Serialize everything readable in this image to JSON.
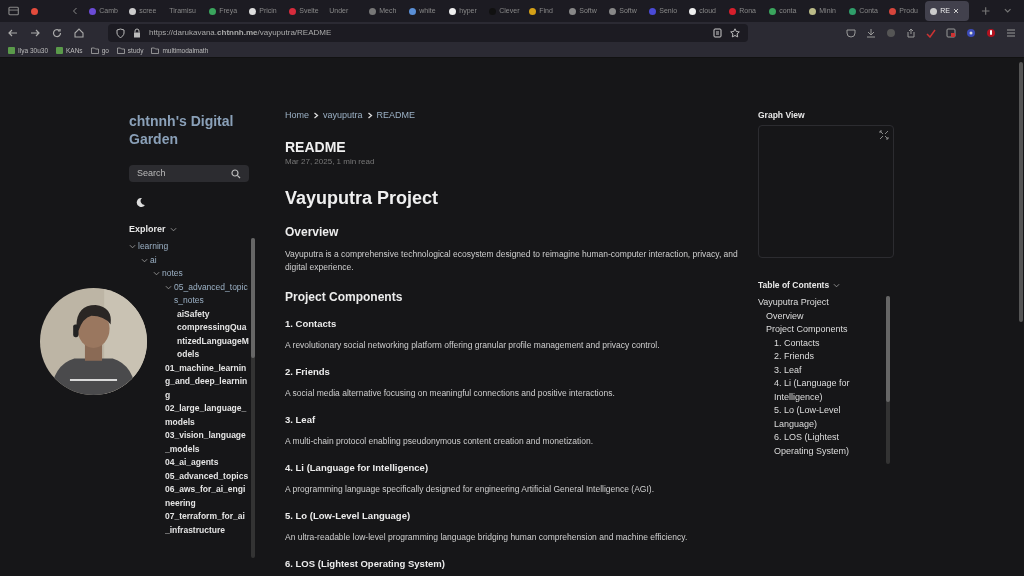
{
  "browser": {
    "tabs": [
      {
        "selected": false,
        "color": "#e44b3c"
      },
      {
        "title": "Camb",
        "selected": false,
        "color": "#6b4bd6"
      },
      {
        "title": "scree",
        "selected": false,
        "color": "#cccccc"
      },
      {
        "title": "Tiramisu",
        "selected": false
      },
      {
        "title": "Freya",
        "selected": false,
        "color": "#3aa55d"
      },
      {
        "title": "Pricin",
        "selected": false,
        "color": "#dddddd"
      },
      {
        "title": "Svelte",
        "selected": false,
        "color": "#d62b3c"
      },
      {
        "title": "Under",
        "selected": false
      },
      {
        "title": "Mech",
        "selected": false,
        "color": "#777777"
      },
      {
        "title": "white",
        "selected": false,
        "color": "#5a8fd6"
      },
      {
        "title": "hyper",
        "selected": false,
        "color": "#eeeeee"
      },
      {
        "title": "Clever",
        "selected": false,
        "color": "#111111"
      },
      {
        "title": "Find",
        "selected": false,
        "color": "#d4a017"
      },
      {
        "title": "Softw",
        "selected": false,
        "color": "#888888"
      },
      {
        "title": "Softw",
        "selected": false,
        "color": "#888888"
      },
      {
        "title": "Senio",
        "selected": false,
        "color": "#4a4ad6"
      },
      {
        "title": "cloud",
        "selected": false,
        "color": "#eeeeee"
      },
      {
        "title": "Rona",
        "selected": false,
        "color": "#d61f2c"
      },
      {
        "title": "conta",
        "selected": false,
        "color": "#3aa55d"
      },
      {
        "title": "Minin",
        "selected": false,
        "color": "#bbbb88"
      },
      {
        "title": "Conta",
        "selected": false,
        "color": "#2f9e6a"
      },
      {
        "title": "Produ",
        "selected": false,
        "color": "#d6453c"
      },
      {
        "title": "RE",
        "selected": true,
        "color": "#cccccc"
      }
    ],
    "url": "https://darukavana.**chtnnh.me**/vayuputra/README",
    "bookmarks": [
      {
        "label": "Ilya 30u30",
        "kind": "site"
      },
      {
        "label": "KANs",
        "kind": "site"
      },
      {
        "label": "go",
        "kind": "folder"
      },
      {
        "label": "study",
        "kind": "folder"
      },
      {
        "label": "multimodalmath",
        "kind": "folder"
      }
    ]
  },
  "sidebar": {
    "site_title": "chtnnh's Digital Garden",
    "search": {
      "placeholder": "Search"
    },
    "explorer": {
      "title": "Explorer",
      "expanded": true,
      "items": [
        {
          "label": "learning",
          "kind": "folder",
          "expanded": true,
          "children": [
            {
              "label": "ai",
              "kind": "folder",
              "expanded": true,
              "children": [
                {
                  "label": "notes",
                  "kind": "folder",
                  "expanded": true,
                  "children": [
                    {
                      "label": "05_advanced_topics_notes",
                      "kind": "folder",
                      "expanded": true,
                      "children": [
                        {
                          "label": "aiSafety",
                          "kind": "file"
                        },
                        {
                          "label": "compressingQuantizedLanguageModels",
                          "kind": "file"
                        }
                      ]
                    },
                    {
                      "label": "01_machine_learning_and_deep_learning",
                      "kind": "file"
                    },
                    {
                      "label": "02_large_language_models",
                      "kind": "file"
                    },
                    {
                      "label": "03_vision_language_models",
                      "kind": "file"
                    },
                    {
                      "label": "04_ai_agents",
                      "kind": "file"
                    },
                    {
                      "label": "05_advanced_topics",
                      "kind": "file"
                    },
                    {
                      "label": "06_aws_for_ai_engineering",
                      "kind": "file"
                    },
                    {
                      "label": "07_terraform_for_ai_infrastructure",
                      "kind": "file"
                    }
                  ]
                }
              ]
            }
          ]
        }
      ]
    }
  },
  "article": {
    "breadcrumbs": [
      "Home",
      "vayuputra",
      "README"
    ],
    "title": "README",
    "meta": "Mar 27, 2025, 1 min read",
    "heading": "Vayuputra Project",
    "blocks": [
      {
        "kind": "h2",
        "text": "Overview"
      },
      {
        "kind": "p",
        "text": "Vayuputra is a comprehensive technological ecosystem designed to reimagine human-computer interaction, privacy, and digital experience."
      },
      {
        "kind": "h2",
        "text": "Project Components"
      },
      {
        "kind": "h3",
        "text": "1. Contacts"
      },
      {
        "kind": "p",
        "text": "A revolutionary social networking platform offering granular profile management and privacy control."
      },
      {
        "kind": "h3",
        "text": "2. Friends"
      },
      {
        "kind": "p",
        "text": "A social media alternative focusing on meaningful connections and positive interactions."
      },
      {
        "kind": "h3",
        "text": "3. Leaf"
      },
      {
        "kind": "p",
        "text": "A multi-chain protocol enabling pseudonymous content creation and monetization."
      },
      {
        "kind": "h3",
        "text": "4. Li (Language for Intelligence)"
      },
      {
        "kind": "p",
        "text": "A programming language specifically designed for engineering Artificial General Intelligence (AGI)."
      },
      {
        "kind": "h3",
        "text": "5. Lo (Low-Level Language)"
      },
      {
        "kind": "p",
        "text": "An ultra-readable low-level programming language bridging human comprehension and machine efficiency."
      },
      {
        "kind": "h3",
        "text": "6. LOS (Lightest Operating System)"
      }
    ]
  },
  "right_panel": {
    "graph_title": "Graph View",
    "toc": {
      "title": "Table of Contents",
      "expanded": true,
      "items": [
        {
          "label": "Vayuputra Project",
          "children": [
            {
              "label": "Overview"
            },
            {
              "label": "Project Components",
              "children": [
                {
                  "label": "1. Contacts"
                },
                {
                  "label": "2. Friends"
                },
                {
                  "label": "3. Leaf"
                },
                {
                  "label": "4. Li (Language for Intelligence)"
                },
                {
                  "label": "5. Lo (Low-Level Language)"
                },
                {
                  "label": "6. LOS (Lightest Operating System)"
                }
              ]
            }
          ]
        }
      ]
    }
  }
}
